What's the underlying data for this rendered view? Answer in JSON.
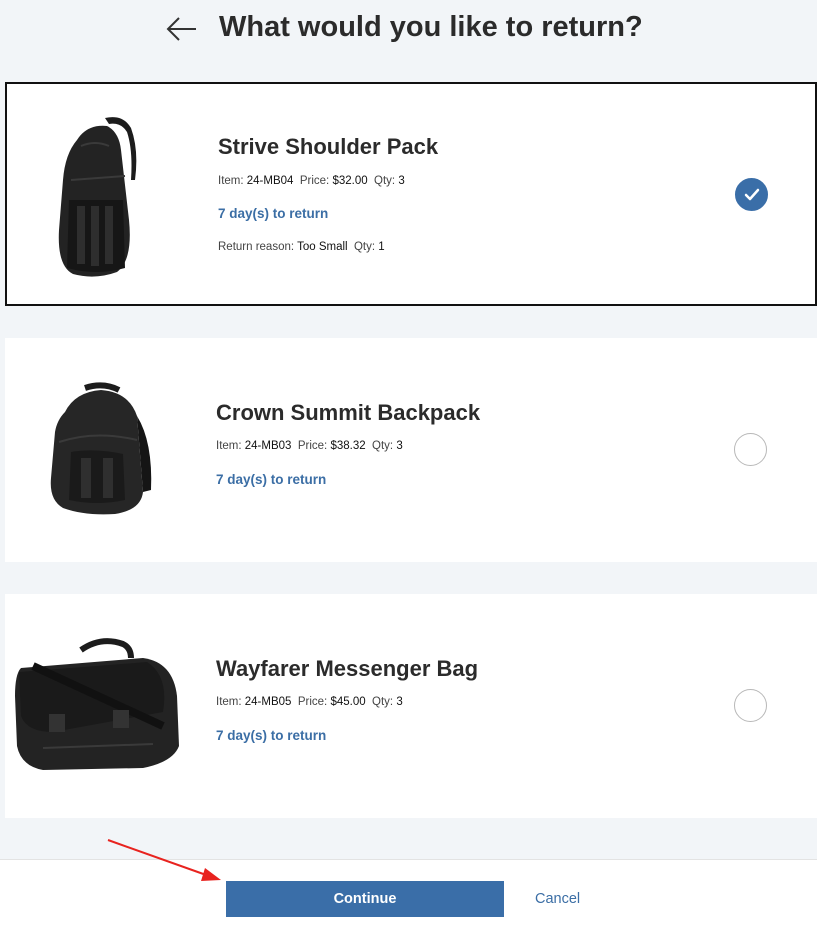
{
  "header": {
    "back_icon": "left-arrow-icon",
    "title": "What would you like to return?"
  },
  "items": [
    {
      "name": "Strive Shoulder Pack",
      "item_label": "Item:",
      "sku": "24-MB04",
      "price_label": "Price:",
      "price": "$32.00",
      "qty_label": "Qty:",
      "qty": "3",
      "days_to_return": "7 day(s) to return",
      "return_reason_label": "Return reason:",
      "return_reason": "Too Small",
      "return_qty_label": "Qty:",
      "return_qty": "1",
      "selected": true,
      "image_icon": "shoulder-pack-image"
    },
    {
      "name": "Crown Summit Backpack",
      "item_label": "Item:",
      "sku": "24-MB03",
      "price_label": "Price:",
      "price": "$38.32",
      "qty_label": "Qty:",
      "qty": "3",
      "days_to_return": "7 day(s) to return",
      "selected": false,
      "image_icon": "backpack-image"
    },
    {
      "name": "Wayfarer Messenger Bag",
      "item_label": "Item:",
      "sku": "24-MB05",
      "price_label": "Price:",
      "price": "$45.00",
      "qty_label": "Qty:",
      "qty": "3",
      "days_to_return": "7 day(s) to return",
      "selected": false,
      "image_icon": "messenger-bag-image"
    }
  ],
  "footer": {
    "continue_label": "Continue",
    "cancel_label": "Cancel"
  },
  "colors": {
    "accent": "#3a6ea8",
    "link": "#3b6ea5",
    "page_background": "#f2f5f8",
    "annotation_arrow": "#e8231f"
  }
}
